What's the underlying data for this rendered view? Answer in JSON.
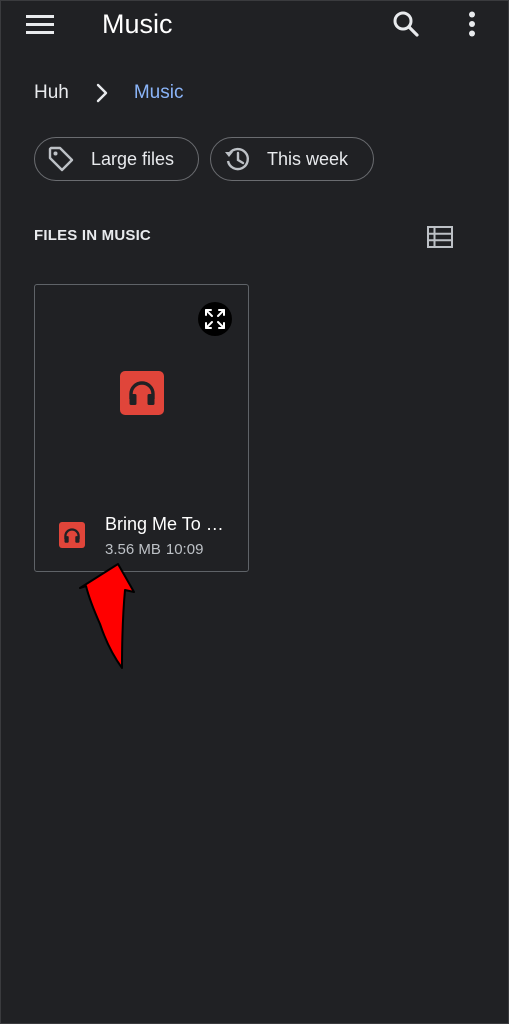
{
  "appbar": {
    "title": "Music",
    "menu_icon": "menu-icon",
    "search_icon": "search-icon",
    "more_icon": "more-vert-icon"
  },
  "breadcrumb": {
    "root": "Huh",
    "separator_icon": "chevron-right-icon",
    "current": "Music"
  },
  "chips": [
    {
      "label": "Large files",
      "icon": "tag-icon"
    },
    {
      "label": "This week",
      "icon": "history-icon"
    }
  ],
  "section": {
    "title": "FILES IN MUSIC",
    "view_toggle_icon": "list-view-icon"
  },
  "files": [
    {
      "name": "Bring Me To …",
      "size": "3.56 MB",
      "time": "10:09",
      "type_icon": "headphones-icon",
      "expand_icon": "fullscreen-icon"
    }
  ],
  "colors": {
    "background": "#202124",
    "accent": "#8ab4f8",
    "audio_icon": "#e0453a",
    "annotation_arrow": "#ff0000"
  }
}
